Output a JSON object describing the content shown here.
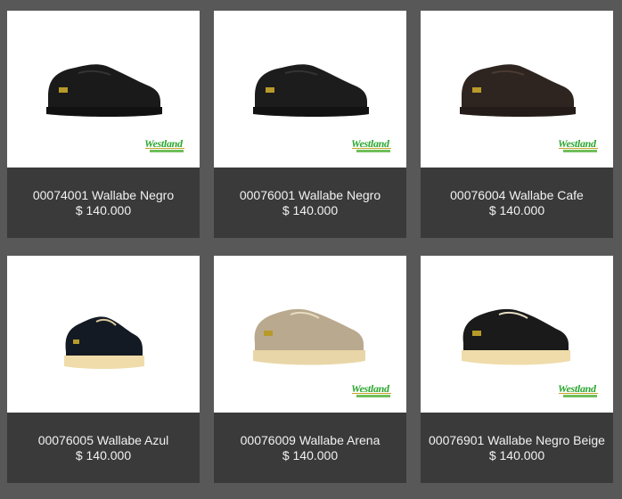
{
  "products": [
    {
      "title": "00074001 Wallabe Negro",
      "price": "$ 140.000",
      "brand": "Westland",
      "image_icon": "black-shoe-icon",
      "color": "#1a1a1a",
      "sole": "#1a1a1a",
      "has_brand": true
    },
    {
      "title": "00076001 Wallabe Negro",
      "price": "$ 140.000",
      "brand": "Westland",
      "image_icon": "black-shoe-icon",
      "color": "#1c1c1c",
      "sole": "#1c1c1c",
      "has_brand": true
    },
    {
      "title": "00076004 Wallabe Cafe",
      "price": "$ 140.000",
      "brand": "Westland",
      "image_icon": "brown-shoe-icon",
      "color": "#2e2420",
      "sole": "#2a2220",
      "has_brand": true
    },
    {
      "title": "00076005 Wallabe Azul",
      "price": "$ 140.000",
      "brand": "",
      "image_icon": "navy-shoe-icon",
      "color": "#141a24",
      "sole": "#efdcaa",
      "has_brand": false
    },
    {
      "title": "00076009 Wallabe Arena",
      "price": "$ 140.000",
      "brand": "Westland",
      "image_icon": "sand-shoe-icon",
      "color": "#b9a98e",
      "sole": "#e9d6a8",
      "has_brand": true
    },
    {
      "title": "00076901 Wallabe Negro Beige",
      "price": "$ 140.000",
      "brand": "Westland",
      "image_icon": "black-beige-shoe-icon",
      "color": "#1a1a1a",
      "sole": "#efdcaa",
      "has_brand": true
    }
  ]
}
